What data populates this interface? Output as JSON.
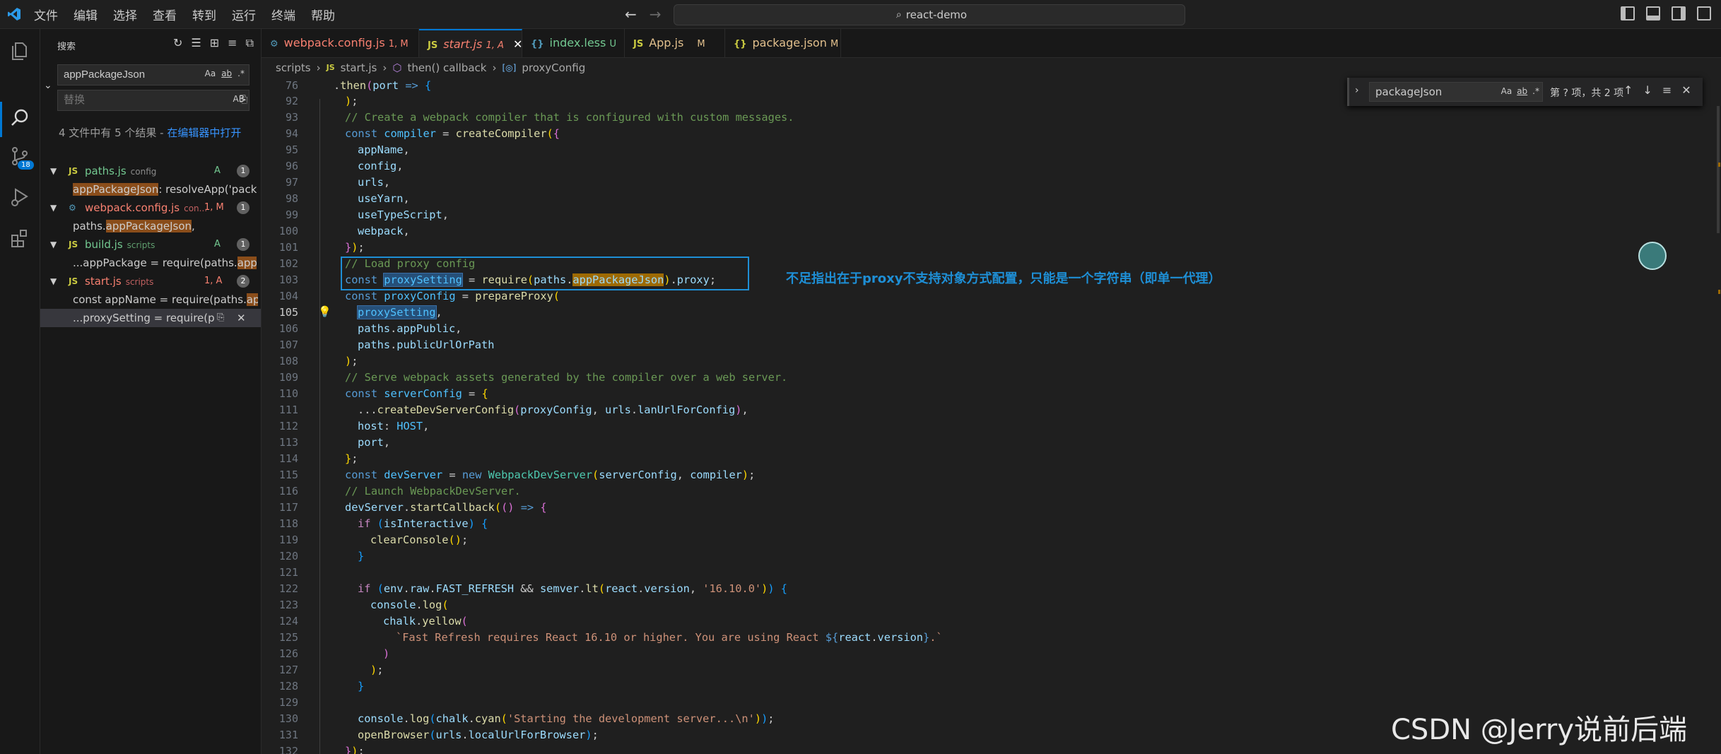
{
  "app": {
    "title": "react-demo"
  },
  "menu": [
    "文件",
    "编辑",
    "选择",
    "查看",
    "转到",
    "运行",
    "终端",
    "帮助"
  ],
  "activity_badge": "18",
  "sidebar": {
    "title": "搜索",
    "search_value": "appPackageJson",
    "replace_placeholder": "替换",
    "summary_prefix": "4 文件中有 5 个结果 - ",
    "summary_link": "在编辑器中打开",
    "results": [
      {
        "file": "paths.js",
        "dir": "config",
        "status": "A",
        "count": "1",
        "match_pre": "",
        "match_hl": "appPackageJson",
        "match_post": ": resolveApp('packa..."
      },
      {
        "file": "webpack.config.js",
        "dir": "con...",
        "status": "1, M",
        "count": "1",
        "match_pre": "paths.",
        "match_hl": "appPackageJson",
        "match_post": ","
      },
      {
        "file": "build.js",
        "dir": "scripts",
        "status": "A",
        "count": "1",
        "match_pre": "...appPackage = require(paths.",
        "match_hl": "appPa",
        "match_post": ""
      },
      {
        "file": "start.js",
        "dir": "scripts",
        "status": "1, A",
        "count": "2",
        "match_pre": "const appName = require(paths.",
        "match_hl": "app...",
        "match_post": "",
        "match2": "...proxySetting = require(p..."
      }
    ]
  },
  "tabs": [
    {
      "label": "webpack.config.js",
      "status": "1, M",
      "icon": "⚙"
    },
    {
      "label": "start.js",
      "status": "1, A",
      "icon": "JS"
    },
    {
      "label": "index.less",
      "status": "U",
      "icon": "{}"
    },
    {
      "label": "App.js",
      "status": "M",
      "icon": "JS"
    },
    {
      "label": "package.json",
      "status": "M",
      "icon": "{}"
    }
  ],
  "breadcrumb": [
    "scripts",
    "start.js",
    "then() callback",
    "proxyConfig"
  ],
  "find_widget": {
    "value": "packageJson",
    "count": "第 ? 项，共 2 项"
  },
  "annotation": "不足指出在于proxy不支持对象方式配置，只能是一个字符串（即单一代理）",
  "watermark": "CSDN @Jerry说前后端",
  "line_numbers": [
    "76",
    "92",
    "93",
    "94",
    "95",
    "96",
    "97",
    "98",
    "99",
    "100",
    "101",
    "102",
    "103",
    "104",
    "105",
    "106",
    "107",
    "108",
    "109",
    "110",
    "111",
    "112",
    "113",
    "114",
    "115",
    "116",
    "117",
    "118",
    "119",
    "120",
    "121",
    "122",
    "123",
    "124",
    "125",
    "126",
    "127",
    "128",
    "129",
    "130",
    "131",
    "132"
  ],
  "current_line": "105",
  "colors": {
    "accent": "#0078d4",
    "annotation": "#1e8fd6",
    "modified": "#e2c08d",
    "added": "#73c991",
    "error": "#f14c4c"
  }
}
